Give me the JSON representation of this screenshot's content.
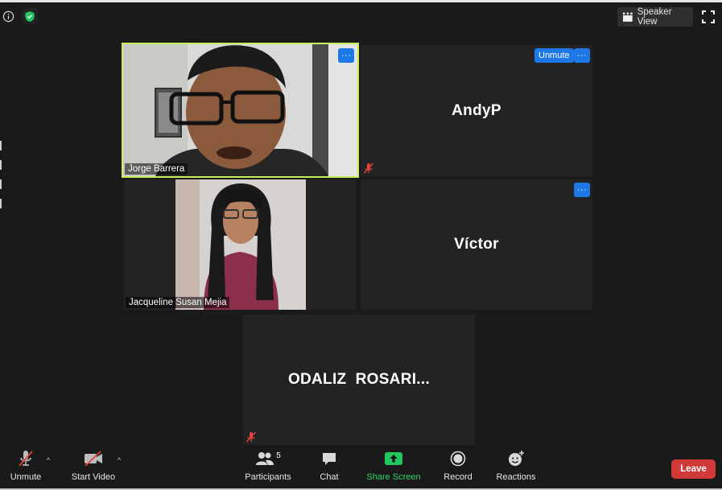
{
  "topbar": {
    "speaker_view_label": "Speaker View"
  },
  "participants": {
    "jorge": {
      "name": "Jorge Barrera"
    },
    "andy": {
      "name": "AndyP",
      "unmute_label": "Unmute"
    },
    "jacqueline": {
      "name": "Jacqueline Susan Mejia"
    },
    "victor": {
      "name": "Víctor"
    },
    "odaliz": {
      "name": "ODALIZ  ROSARI..."
    }
  },
  "menu_glyph": "···",
  "toolbar": {
    "unmute_label": "Unmute",
    "start_video_label": "Start Video",
    "participants_label": "Participants",
    "participants_count": "5",
    "chat_label": "Chat",
    "share_screen_label": "Share Screen",
    "record_label": "Record",
    "reactions_label": "Reactions",
    "leave_label": "Leave"
  },
  "colors": {
    "background": "#1a1a1a",
    "tile": "#232323",
    "accent_blue": "#1e78e6",
    "active_speaker_border": "#c9ee5a",
    "share_green": "#22c55e",
    "leave_red": "#d23a3a",
    "muted_red": "#e0443c"
  }
}
